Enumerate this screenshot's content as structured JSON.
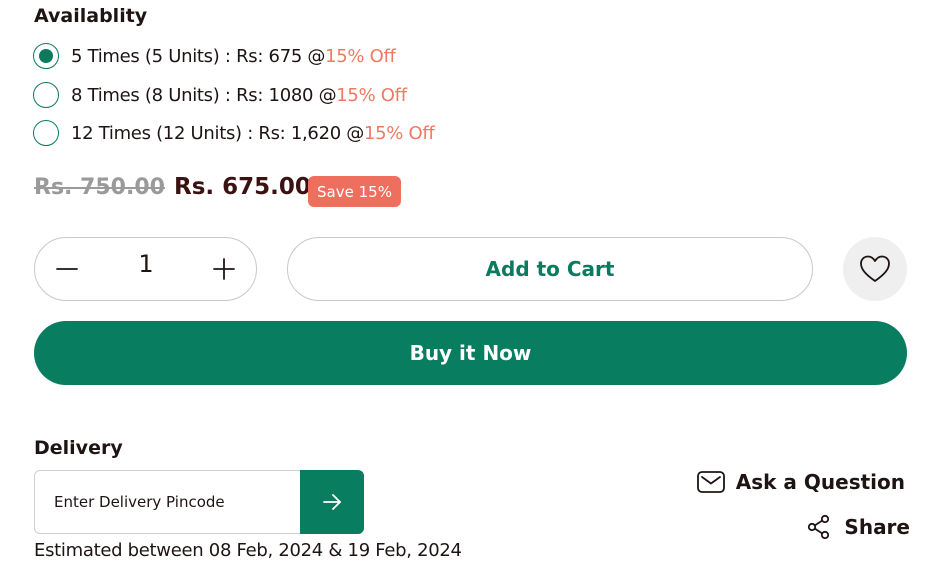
{
  "availability": {
    "heading": "Availablity",
    "options": [
      {
        "text": "5 Times (5 Units) : Rs: 675 @",
        "discount": "15% Off",
        "selected": true
      },
      {
        "text": "8 Times (8 Units) : Rs: 1080 @",
        "discount": "15% Off",
        "selected": false
      },
      {
        "text": "12 Times (12 Units) : Rs: 1,620 @",
        "discount": "15% Off",
        "selected": false
      }
    ]
  },
  "price": {
    "original": "Rs. 750.00",
    "current": "Rs. 675.00",
    "save_badge": "Save 15%"
  },
  "quantity": {
    "value": "1"
  },
  "buttons": {
    "add_to_cart": "Add to Cart",
    "buy_now": "Buy it Now"
  },
  "delivery": {
    "heading": "Delivery",
    "placeholder": "Enter Delivery Pincode",
    "estimate": "Estimated between 08 Feb, 2024 & 19 Feb, 2024"
  },
  "actions": {
    "ask_question": "Ask a Question",
    "share": "Share"
  },
  "icons": {
    "minus": "minus-icon",
    "plus": "plus-icon",
    "wishlist": "heart-icon",
    "submit": "arrow-right-icon",
    "ask": "envelope-icon",
    "share": "share-icon"
  },
  "colors": {
    "brand_green": "#097d5f",
    "discount_coral": "#ef7a64",
    "badge_red": "#ef6f5e",
    "price_dark": "#3a1212"
  }
}
